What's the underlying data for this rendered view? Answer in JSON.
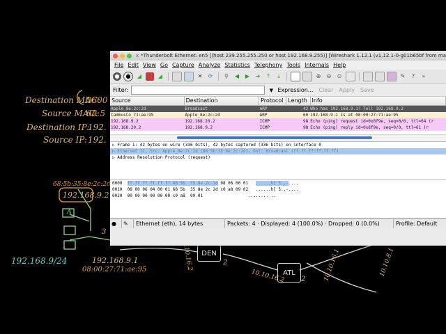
{
  "background": {
    "labels_left": [
      "Destination MAC:",
      "Source MAC:",
      "Destination IP:",
      "Source IP:"
    ],
    "values_left": [
      "D600",
      "68:5",
      "192.",
      "192."
    ],
    "mac_orange": "68:5b:35:8e:2c:2d",
    "ip_top": "192.168.9.2",
    "node_A": "A",
    "port_3": "3",
    "subnet": "192.168.9/24",
    "router_ip": "192.168.9.1",
    "router_mac": "08:00:27:71:ae:95",
    "net_left": "10.10.16.2",
    "router_den": "DEN",
    "port_2a": "2",
    "net_right": "10.10.16.2",
    "router_atl": "ATL",
    "port_2b": "2",
    "net_far": "10.10.16.1",
    "net_top": "10.10.8.1"
  },
  "window": {
    "title": "*Thunderbolt Ethernet: en5 [(host 239.255.255.250 or host 192.168.9.255)]  [Wireshark 1.12.1 (v1.12.1-0-g01b65bf from master-1.12)]",
    "title_icon": "x"
  },
  "menu": [
    "File",
    "Edit",
    "View",
    "Go",
    "Capture",
    "Analyze",
    "Statistics",
    "Telephony",
    "Tools",
    "Internals",
    "Help"
  ],
  "filter": {
    "label": "Filter:",
    "value": "",
    "expression": "Expression...",
    "clear": "Clear",
    "apply": "Apply",
    "save": "Save"
  },
  "columns": [
    "Source",
    "Destination",
    "Protocol",
    "Length",
    "Info"
  ],
  "packets": [
    {
      "source": "Apple_8e:2c:2d",
      "destination": "Broadcast",
      "protocol": "ARP",
      "length": "42",
      "info": "Who has 192.168.9.1?  Tell 192.168.9.2",
      "bg": "#565656",
      "fg": "#dcdcdc"
    },
    {
      "source": "CadmusCo_71:ae:95",
      "destination": "Apple_8e:2c:2d",
      "protocol": "ARP",
      "length": "60",
      "info": "192.168.9.1 is at 08:00:27:71:ae:95",
      "bg": "#fbf1d2",
      "fg": "#222222"
    },
    {
      "source": "192.168.9.2",
      "destination": "192.168.20.2",
      "protocol": "ICMP",
      "length": "98",
      "info": "Echo (ping) request  id=0x8f9e, seq=0/0, ttl=64 (r",
      "bg": "#f7c9f7",
      "fg": "#222222"
    },
    {
      "source": "192.168.20.2",
      "destination": "192.168.9.2",
      "protocol": "ICMP",
      "length": "98",
      "info": "Echo (ping) reply    id=0x8f9e, seq=0/0, ttl=61 (r",
      "bg": "#f7c9f7",
      "fg": "#222222"
    }
  ],
  "details": [
    {
      "text": "▷ Frame 1: 42 bytes on wire (336 bits), 42 bytes captured (336 bits) on interface 0",
      "selected": false
    },
    {
      "text": "▷ Ethernet II, Src: Apple_8e:2c:2d (68:5b:35:8e:2c:2d), Dst: Broadcast (ff:ff:ff:ff:ff:ff)",
      "selected": true
    },
    {
      "text": "▷ Address Resolution Protocol (request)",
      "selected": false
    }
  ],
  "bytes": [
    {
      "offset": "0000",
      "hl": "ff ff ff ff ff ff 68 5b  35 8e 2c 2d",
      "rest": " 08 06 00 01",
      "ascii_hl": "......h[ 5.,-",
      "ascii_rest": "...."
    },
    {
      "offset": "0010",
      "hl": "",
      "rest": "08 00 06 04 00 01 68 5b  35 8e 2c 2d c0 a8 09 02",
      "ascii_hl": "",
      "ascii_rest": "......h[ 5.,-...."
    },
    {
      "offset": "0020",
      "hl": "",
      "rest": "00 00 00 00 00 00 c0 a8  09 01",
      "ascii_hl": "",
      "ascii_rest": "........ .."
    }
  ],
  "status": {
    "protocol": "Ethernet (eth), 14 bytes",
    "packets": "Packets: 4 · Displayed: 4 (100.0%) · Dropped: 0 (0.0%)",
    "profile": "Profile: Default"
  }
}
